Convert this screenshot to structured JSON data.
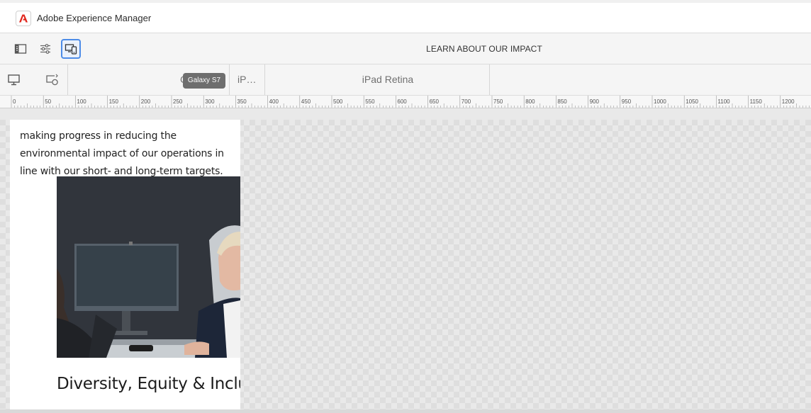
{
  "app": {
    "title": "Adobe Experience Manager"
  },
  "toolbar": {
    "page_title": "LEARN ABOUT OUR IMPACT",
    "buttons": [
      {
        "icon": "side-panel-icon"
      },
      {
        "icon": "properties-icon"
      },
      {
        "icon": "emulator-icon",
        "active": true
      }
    ]
  },
  "emulator": {
    "devices": [
      {
        "label": ""
      },
      {
        "label": "iP…"
      },
      {
        "label": "iPad Retina"
      }
    ],
    "tooltip": "Galaxy S7",
    "partial_glyph": "C"
  },
  "ruler": {
    "labels": [
      "0",
      "50",
      "100",
      "150",
      "200",
      "250",
      "300",
      "350",
      "400",
      "450",
      "500",
      "550",
      "600",
      "650",
      "700",
      "750",
      "800",
      "850",
      "900",
      "950",
      "1000",
      "1050",
      "1100",
      "1150",
      "1200"
    ]
  },
  "content": {
    "paragraph": "making progress in reducing the environmental impact of our operations in line with our short- and long-term targets.",
    "heading": "Diversity, Equity & Inclusion"
  },
  "colors": {
    "accent": "#4d8ce8",
    "adobe_red": "#e1251b",
    "tooltip_bg": "#6e6e6e"
  }
}
